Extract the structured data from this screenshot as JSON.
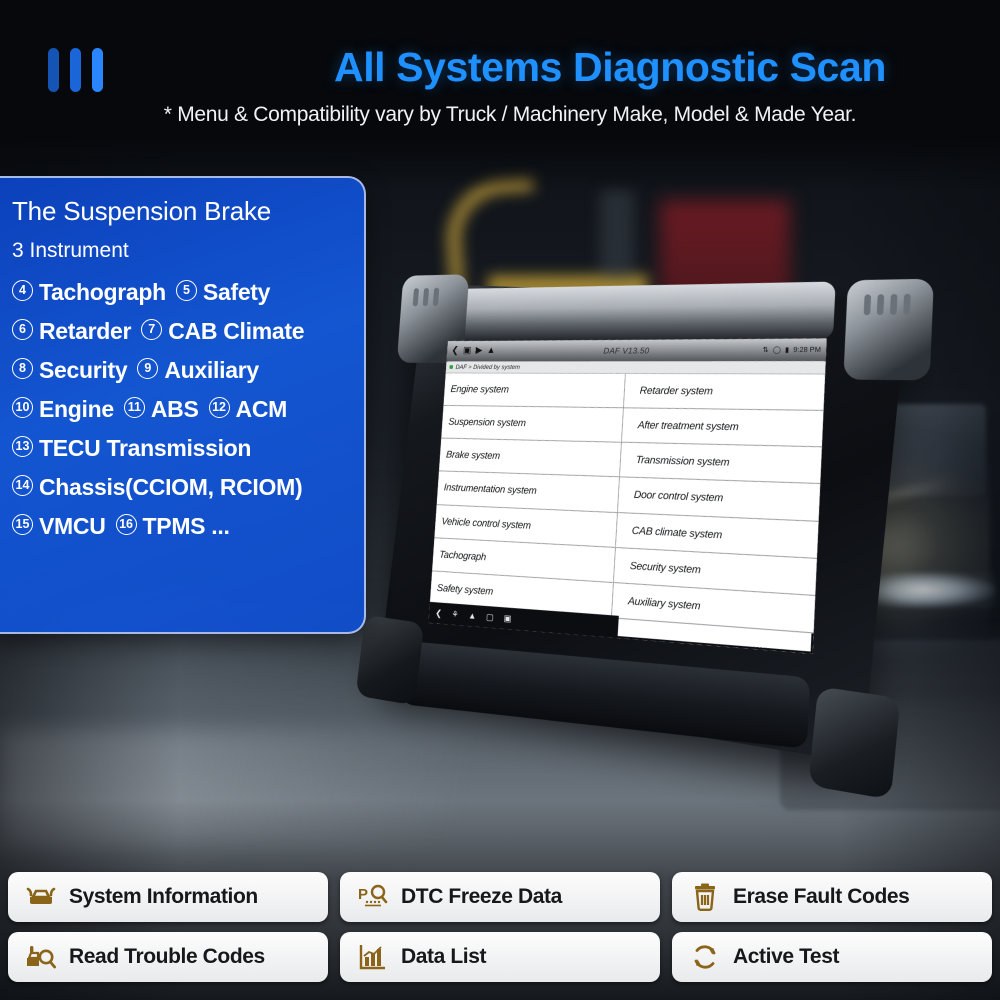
{
  "header": {
    "logo_icon": "three-bars-logo-icon",
    "title": "All Systems Diagnostic Scan",
    "subtitle": "* Menu & Compatibility vary by Truck / Machinery Make, Model & Made Year.",
    "title_color": "#1E90FF"
  },
  "panel": {
    "title": "The Suspension Brake",
    "subtitle": "3 Instrument",
    "bg_color": "#0C45C8",
    "rows": [
      [
        {
          "num": "4",
          "label": "Tachograph"
        },
        {
          "num": "5",
          "label": "Safety"
        }
      ],
      [
        {
          "num": "6",
          "label": "Retarder"
        },
        {
          "num": "7",
          "label": "CAB Climate"
        }
      ],
      [
        {
          "num": "8",
          "label": "Security"
        },
        {
          "num": "9",
          "label": "Auxiliary"
        }
      ],
      [
        {
          "num": "10",
          "label": "Engine"
        },
        {
          "num": "11",
          "label": "ABS"
        },
        {
          "num": "12",
          "label": "ACM"
        }
      ],
      [
        {
          "num": "13",
          "label": "TECU Transmission"
        }
      ],
      [
        {
          "num": "14",
          "label": "Chassis(CCIOM, RCIOM)"
        }
      ],
      [
        {
          "num": "15",
          "label": "VMCU"
        },
        {
          "num": "16",
          "label": "TPMS ..."
        }
      ]
    ]
  },
  "tablet": {
    "app_title": "DAF V13.50",
    "breadcrumb": "DAF > Divided by system",
    "clock": "9:28 PM",
    "toolbar_icons": [
      "back-icon",
      "screenshot-icon",
      "record-icon",
      "home-icon"
    ],
    "status_icons": [
      "bluetooth-icon",
      "info-icon",
      "battery-icon"
    ],
    "navbar_icons": [
      "back-icon",
      "bug-icon",
      "home-icon",
      "recents-icon",
      "screenshot-icon"
    ],
    "list": {
      "left_column": [
        "Engine system",
        "Suspension system",
        "Brake system",
        "Instrumentation system",
        "Vehicle control system",
        "Tachograph",
        "Safety system"
      ],
      "right_column": [
        "Retarder system",
        "After treatment system",
        "Transmission system",
        "Door control system",
        "CAB climate system",
        "Security system",
        "Auxiliary system"
      ]
    }
  },
  "actions": {
    "icon_color": "#8a6418",
    "buttons": [
      {
        "label": "System Information",
        "icon": "car-hood-icon"
      },
      {
        "label": "DTC Freeze Data",
        "icon": "dtc-magnifier-icon"
      },
      {
        "label": "Erase Fault Codes",
        "icon": "trash-icon"
      },
      {
        "label": "Read Trouble Codes",
        "icon": "car-magnifier-icon"
      },
      {
        "label": "Data List",
        "icon": "bar-chart-icon"
      },
      {
        "label": "Active Test",
        "icon": "refresh-cycle-icon"
      }
    ]
  }
}
